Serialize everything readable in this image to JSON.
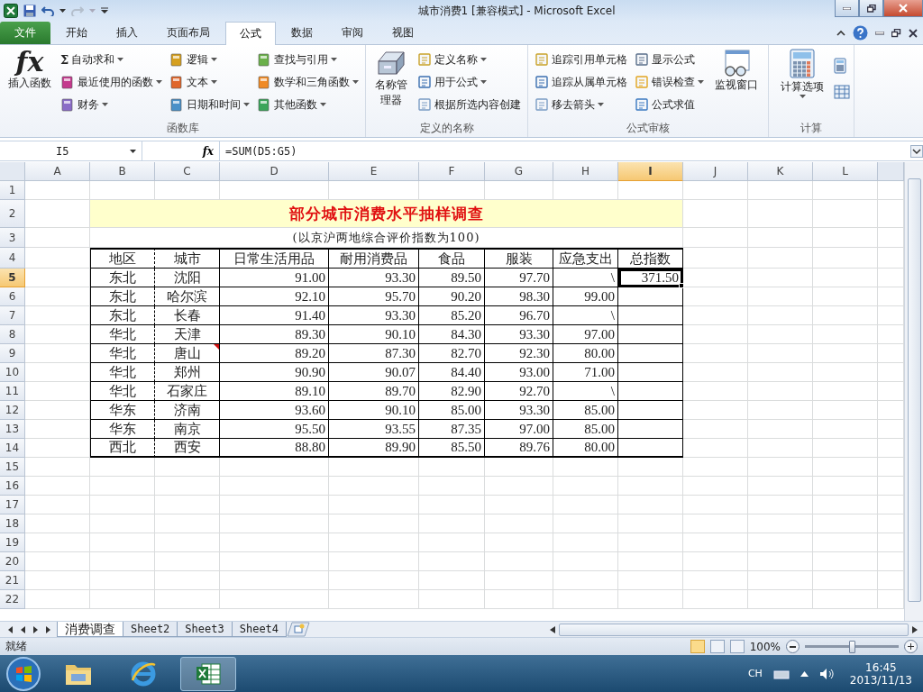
{
  "window": {
    "title": "城市消费1  [兼容模式]  -  Microsoft Excel"
  },
  "ribbon": {
    "tabs": [
      {
        "label": "文件",
        "selected": false,
        "kind": "file"
      },
      {
        "label": "开始",
        "selected": false,
        "kind": "tab"
      },
      {
        "label": "插入",
        "selected": false,
        "kind": "tab"
      },
      {
        "label": "页面布局",
        "selected": false,
        "kind": "tab"
      },
      {
        "label": "公式",
        "selected": true,
        "kind": "tab"
      },
      {
        "label": "数据",
        "selected": false,
        "kind": "tab"
      },
      {
        "label": "审阅",
        "selected": false,
        "kind": "tab"
      },
      {
        "label": "视图",
        "selected": false,
        "kind": "tab"
      }
    ],
    "groups": [
      {
        "label": "函数库",
        "large": [
          {
            "label": "插入函数",
            "glyph": "fx",
            "dropdown": false
          }
        ],
        "columns": [
          [
            {
              "label": "自动求和",
              "glyph": "Σ",
              "dropdown": true
            },
            {
              "label": "最近使用的函数",
              "dropdown": true
            },
            {
              "label": "财务",
              "dropdown": true
            }
          ],
          [
            {
              "label": "逻辑",
              "dropdown": true
            },
            {
              "label": "文本",
              "dropdown": true
            },
            {
              "label": "日期和时间",
              "dropdown": true
            }
          ],
          [
            {
              "label": "查找与引用",
              "dropdown": true
            },
            {
              "label": "数学和三角函数",
              "dropdown": true
            },
            {
              "label": "其他函数",
              "dropdown": true
            }
          ]
        ]
      },
      {
        "label": "定义的名称",
        "large": [
          {
            "label": "名称管理器",
            "dropdown": false
          }
        ],
        "columns": [
          [
            {
              "label": "定义名称",
              "dropdown": true
            },
            {
              "label": "用于公式",
              "dropdown": true
            },
            {
              "label": "根据所选内容创建",
              "dropdown": false
            }
          ]
        ]
      },
      {
        "label": "公式审核",
        "columns": [
          [
            {
              "label": "追踪引用单元格",
              "dropdown": false
            },
            {
              "label": "追踪从属单元格",
              "dropdown": false
            },
            {
              "label": "移去箭头",
              "dropdown": true
            }
          ],
          [
            {
              "label": "显示公式",
              "dropdown": false
            },
            {
              "label": "错误检查",
              "dropdown": true
            },
            {
              "label": "公式求值",
              "dropdown": false
            }
          ]
        ],
        "trailing": [
          {
            "label": "监视窗口",
            "dropdown": false
          }
        ]
      },
      {
        "label": "计算",
        "large": [
          {
            "label": "计算选项",
            "dropdown": true
          }
        ],
        "icon_buttons": true
      }
    ]
  },
  "formula_bar": {
    "name_box": "I5",
    "fx": "fx",
    "formula": "=SUM(D5:G5)"
  },
  "sheet": {
    "columns": [
      {
        "label": "A",
        "selected": false
      },
      {
        "label": "B",
        "selected": false
      },
      {
        "label": "C",
        "selected": false
      },
      {
        "label": "D",
        "selected": false
      },
      {
        "label": "E",
        "selected": false
      },
      {
        "label": "F",
        "selected": false
      },
      {
        "label": "G",
        "selected": false
      },
      {
        "label": "H",
        "selected": false
      },
      {
        "label": "I",
        "selected": true
      },
      {
        "label": "J",
        "selected": false
      },
      {
        "label": "K",
        "selected": false
      },
      {
        "label": "L",
        "selected": false
      }
    ],
    "rows": [
      {
        "label": "1",
        "selected": false,
        "kind": "empty"
      },
      {
        "label": "2",
        "selected": false,
        "kind": "title",
        "text": "部分城市消费水平抽样调查"
      },
      {
        "label": "3",
        "selected": false,
        "kind": "subtitle",
        "text": "(以京沪两地综合评价指数为100)"
      },
      {
        "label": "4",
        "selected": false,
        "kind": "header",
        "cells": [
          "地区",
          "城市",
          "日常生活用品",
          "耐用消费品",
          "食品",
          "服装",
          "应急支出",
          "总指数"
        ]
      },
      {
        "label": "5",
        "selected": true,
        "kind": "record",
        "cells": [
          {
            "text": "东北",
            "comment": false
          },
          {
            "text": "沈阳",
            "comment": false
          },
          {
            "text": "91.00",
            "comment": false
          },
          {
            "text": "93.30",
            "comment": false
          },
          {
            "text": "89.50",
            "comment": false
          },
          {
            "text": "97.70",
            "comment": false
          },
          {
            "text": "\\",
            "comment": false
          },
          {
            "text": "371.50",
            "comment": false
          }
        ]
      },
      {
        "label": "6",
        "selected": false,
        "kind": "record",
        "cells": [
          {
            "text": "东北",
            "comment": false
          },
          {
            "text": "哈尔滨",
            "comment": false
          },
          {
            "text": "92.10",
            "comment": false
          },
          {
            "text": "95.70",
            "comment": false
          },
          {
            "text": "90.20",
            "comment": false
          },
          {
            "text": "98.30",
            "comment": false
          },
          {
            "text": "99.00",
            "comment": false
          },
          {
            "comment": false
          }
        ]
      },
      {
        "label": "7",
        "selected": false,
        "kind": "record",
        "cells": [
          {
            "text": "东北",
            "comment": false
          },
          {
            "text": "长春",
            "comment": false
          },
          {
            "text": "91.40",
            "comment": false
          },
          {
            "text": "93.30",
            "comment": false
          },
          {
            "text": "85.20",
            "comment": false
          },
          {
            "text": "96.70",
            "comment": false
          },
          {
            "text": "\\",
            "comment": false
          },
          {
            "comment": false
          }
        ]
      },
      {
        "label": "8",
        "selected": false,
        "kind": "record",
        "cells": [
          {
            "text": "华北",
            "comment": false
          },
          {
            "text": "天津",
            "comment": false
          },
          {
            "text": "89.30",
            "comment": false
          },
          {
            "text": "90.10",
            "comment": false
          },
          {
            "text": "84.30",
            "comment": false
          },
          {
            "text": "93.30",
            "comment": false
          },
          {
            "text": "97.00",
            "comment": false
          },
          {
            "comment": false
          }
        ]
      },
      {
        "label": "9",
        "selected": false,
        "kind": "record",
        "cells": [
          {
            "text": "华北",
            "comment": false
          },
          {
            "text": "唐山",
            "comment": true
          },
          {
            "text": "89.20",
            "comment": false
          },
          {
            "text": "87.30",
            "comment": false
          },
          {
            "text": "82.70",
            "comment": false
          },
          {
            "text": "92.30",
            "comment": false
          },
          {
            "text": "80.00",
            "comment": false
          },
          {
            "comment": false
          }
        ]
      },
      {
        "label": "10",
        "selected": false,
        "kind": "record",
        "cells": [
          {
            "text": "华北",
            "comment": false
          },
          {
            "text": "郑州",
            "comment": false
          },
          {
            "text": "90.90",
            "comment": false
          },
          {
            "text": "90.07",
            "comment": false
          },
          {
            "text": "84.40",
            "comment": false
          },
          {
            "text": "93.00",
            "comment": false
          },
          {
            "text": "71.00",
            "comment": false
          },
          {
            "comment": false
          }
        ]
      },
      {
        "label": "11",
        "selected": false,
        "kind": "record",
        "cells": [
          {
            "text": "华北",
            "comment": false
          },
          {
            "text": "石家庄",
            "comment": false
          },
          {
            "text": "89.10",
            "comment": false
          },
          {
            "text": "89.70",
            "comment": false
          },
          {
            "text": "82.90",
            "comment": false
          },
          {
            "text": "92.70",
            "comment": false
          },
          {
            "text": "\\",
            "comment": false
          },
          {
            "comment": false
          }
        ]
      },
      {
        "label": "12",
        "selected": false,
        "kind": "record",
        "cells": [
          {
            "text": "华东",
            "comment": false
          },
          {
            "text": "济南",
            "comment": false
          },
          {
            "text": "93.60",
            "comment": false
          },
          {
            "text": "90.10",
            "comment": false
          },
          {
            "text": "85.00",
            "comment": false
          },
          {
            "text": "93.30",
            "comment": false
          },
          {
            "text": "85.00",
            "comment": false
          },
          {
            "comment": false
          }
        ]
      },
      {
        "label": "13",
        "selected": false,
        "kind": "record",
        "cells": [
          {
            "text": "华东",
            "comment": false
          },
          {
            "text": "南京",
            "comment": false
          },
          {
            "text": "95.50",
            "comment": false
          },
          {
            "text": "93.55",
            "comment": false
          },
          {
            "text": "87.35",
            "comment": false
          },
          {
            "text": "97.00",
            "comment": false
          },
          {
            "text": "85.00",
            "comment": false
          },
          {
            "comment": false
          }
        ]
      },
      {
        "label": "14",
        "selected": false,
        "kind": "record",
        "cells": [
          {
            "text": "西北",
            "comment": false
          },
          {
            "text": "西安",
            "comment": false
          },
          {
            "text": "88.80",
            "comment": false
          },
          {
            "text": "89.90",
            "comment": false
          },
          {
            "text": "85.50",
            "comment": false
          },
          {
            "text": "89.76",
            "comment": false
          },
          {
            "text": "80.00",
            "comment": false
          },
          {
            "comment": false
          }
        ]
      },
      {
        "label": "15",
        "selected": false,
        "kind": "empty"
      },
      {
        "label": "16",
        "selected": false,
        "kind": "empty"
      },
      {
        "label": "17",
        "selected": false,
        "kind": "empty"
      },
      {
        "label": "18",
        "selected": false,
        "kind": "empty"
      },
      {
        "label": "19",
        "selected": false,
        "kind": "empty"
      },
      {
        "label": "20",
        "selected": false,
        "kind": "empty"
      },
      {
        "label": "21",
        "selected": false,
        "kind": "empty"
      },
      {
        "label": "22",
        "selected": false,
        "kind": "empty"
      }
    ]
  },
  "sheet_tabs": [
    {
      "label": "消费调查",
      "selected": true
    },
    {
      "label": "Sheet2",
      "selected": false
    },
    {
      "label": "Sheet3",
      "selected": false
    },
    {
      "label": "Sheet4",
      "selected": false
    }
  ],
  "status_bar": {
    "status": "就绪",
    "zoom": "100%",
    "zoom_slider": {
      "level": 0.5
    }
  },
  "taskbar": {
    "apps": [
      {
        "selected": false
      },
      {
        "selected": false
      },
      {
        "selected": true
      }
    ],
    "language": "CH",
    "time": "16:45",
    "date": "2013/11/13"
  }
}
